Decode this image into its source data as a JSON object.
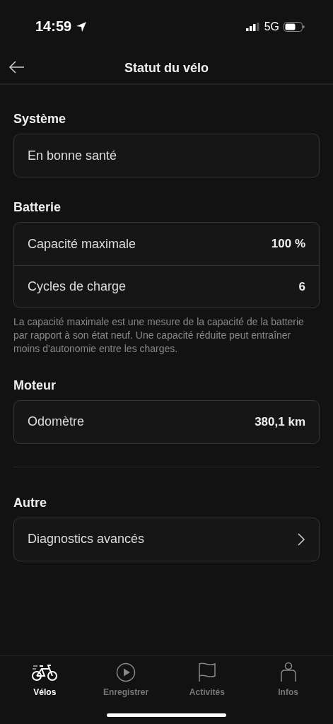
{
  "status_bar": {
    "time": "14:59",
    "network": "5G"
  },
  "header": {
    "title": "Statut du vélo"
  },
  "sections": [
    {
      "title": "Système",
      "separated": false,
      "rows": [
        {
          "kind": "text",
          "label": "En bonne santé"
        }
      ]
    },
    {
      "title": "Batterie",
      "separated": false,
      "rows": [
        {
          "kind": "value",
          "label": "Capacité maximale",
          "value": "100 %"
        },
        {
          "kind": "value",
          "label": "Cycles de charge",
          "value": "6"
        }
      ],
      "note": "La capacité maximale est une mesure de la capacité de la batterie par rapport à son état neuf. Une capacité réduite peut entraîner moins d'autonomie entre les charges."
    },
    {
      "title": "Moteur",
      "separated": false,
      "rows": [
        {
          "kind": "value",
          "label": "Odomètre",
          "value": "380,1 km"
        }
      ]
    },
    {
      "title": "Autre",
      "separated": true,
      "rows": [
        {
          "kind": "link",
          "label": "Diagnostics avancés"
        }
      ]
    }
  ],
  "tab_bar": [
    {
      "kind": "bike",
      "label": "Vélos",
      "selected": true
    },
    {
      "kind": "play",
      "label": "Enregistrer",
      "selected": false
    },
    {
      "kind": "flag",
      "label": "Activités",
      "selected": false
    },
    {
      "kind": "person",
      "label": "Infos",
      "selected": false
    }
  ]
}
